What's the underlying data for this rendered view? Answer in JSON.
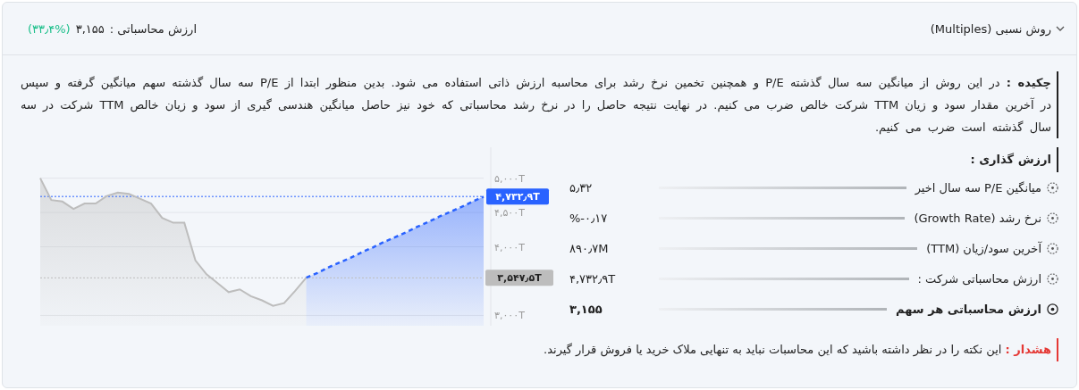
{
  "header": {
    "title": "روش نسبی (Multiples)",
    "expanded": true,
    "result_label": "ارزش محاسباتی :",
    "result_value": "۳,۱۵۵",
    "result_change": "(۳۳٫۴%)"
  },
  "summary": {
    "label": "چکیده :",
    "text": "در این روش از میانگین سه سال گذشته P/E و همچنین تخمین نرخ رشد برای محاسبه ارزش ذاتی استفاده می شود. بدین منظور ابتدا از P/E سه سال گذشته سهم میانگین گرفته و سپس در آخرین مقدار سود و زیان TTM شرکت خالص ضرب می کنیم. در نهایت نتیجه حاصل را در نرخ رشد محاسباتی که خود نیز حاصل میانگین هندسی گیری از سود و زیان خالص TTM شرکت در سه سال گذشته است ضرب می کنیم."
  },
  "chart_data": {
    "type": "area",
    "grid": true,
    "series": [
      {
        "color": "#bdbdbd",
        "line_style": "solid",
        "values": [
          5000,
          4680,
          4660,
          4550,
          4630,
          4630,
          4740,
          4790,
          4770,
          4700,
          4630,
          4420,
          4350,
          4350,
          3800,
          3600,
          3470,
          3340,
          3380,
          3280,
          3220,
          3140,
          3180,
          3360,
          3550,
          null,
          null,
          null,
          null,
          null,
          null,
          null,
          null,
          null,
          null,
          null,
          null,
          null,
          null,
          null,
          null
        ]
      },
      {
        "color": "#2962ff",
        "line_style": "dashed",
        "values": [
          null,
          null,
          null,
          null,
          null,
          null,
          null,
          null,
          null,
          null,
          null,
          null,
          null,
          null,
          null,
          null,
          null,
          null,
          null,
          null,
          null,
          null,
          null,
          null,
          3550,
          3620,
          3700,
          3770,
          3840,
          3920,
          3990,
          4070,
          4140,
          4210,
          4290,
          4360,
          4440,
          4510,
          4580,
          4660,
          4730
        ]
      }
    ],
    "ylim": [
      2850,
      5450
    ],
    "yticks": [
      {
        "value": 3000,
        "label": "۳,۰۰۰T"
      },
      {
        "value": 4000,
        "label": "۴,۰۰۰T"
      },
      {
        "value": 4500,
        "label": "۴,۵۰۰T"
      },
      {
        "value": 5000,
        "label": "۵,۰۰۰T"
      }
    ],
    "ref_lines": [
      {
        "axis": "y",
        "value": 4732.9,
        "label": "۴,۷۳۲٫۹T",
        "color": "#2962ff",
        "line_style": "dotted"
      },
      {
        "axis": "y",
        "value": 3547.5,
        "label": "۳,۵۴۷٫۵T",
        "color": "#bdbdbd",
        "line_style": "dotted"
      }
    ]
  },
  "valuation": {
    "title": "ارزش گذاری :",
    "rows": [
      {
        "kind": "item",
        "label": "میانگین P/E سه سال اخیر",
        "value": "۵٫۳۲"
      },
      {
        "kind": "item",
        "label": "نرخ رشد (Growth Rate)",
        "value": "%-۰٫۱۷"
      },
      {
        "kind": "item",
        "label": "آخرین سود/زیان (TTM)",
        "value": "۸۹۰٫۷M"
      },
      {
        "kind": "item",
        "label": "ارزش محاسباتی شرکت :",
        "value": "۴,۷۳۲٫۹T"
      },
      {
        "kind": "total",
        "label": "ارزش محاسباتی هر سهم",
        "value": "۳,۱۵۵"
      }
    ]
  },
  "warning": {
    "label": "هشدار :",
    "text": "این نکته را در نظر داشته باشید که این محاسبات نباید به تنهایی ملاک خرید یا فروش قرار گیرند."
  }
}
